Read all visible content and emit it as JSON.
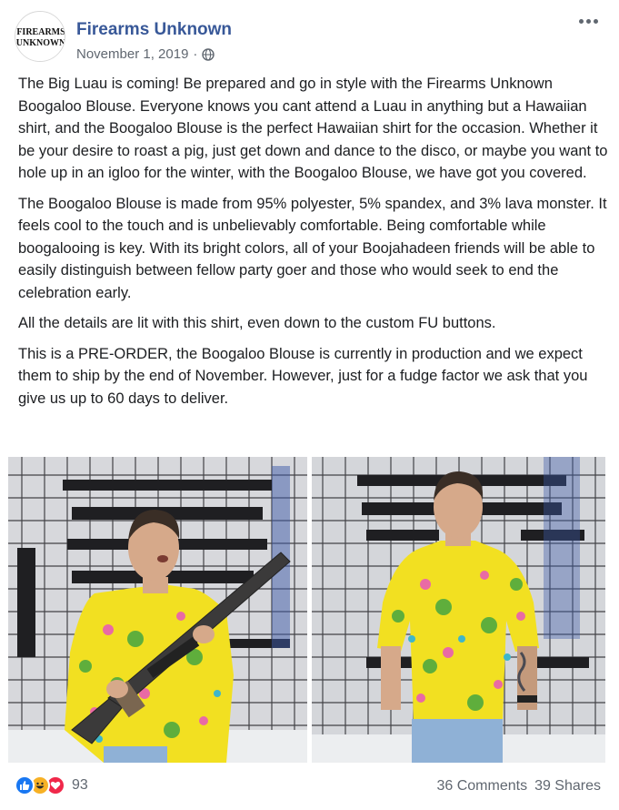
{
  "post": {
    "page_name": "Firearms Unknown",
    "date": "November 1, 2019",
    "separator": "·",
    "avatar_text_top": "FIREARMS",
    "avatar_text_bottom": "UNKNOWN",
    "paragraphs": [
      "The Big Luau is coming! Be prepared and go in style with the Firearms Unknown Boogaloo Blouse. Everyone knows you cant attend a Luau in anything but a Hawaiian shirt, and the Boogaloo Blouse is the perfect Hawaiian shirt for the occasion. Whether it be your desire to roast a pig, just get down and dance to the disco, or maybe you want to hole up in an igloo for the winter, with the Boogaloo Blouse, we have got you covered.",
      "The Boogaloo Blouse is made from 95% polyester, 5% spandex, and 3% lava monster. It feels cool to the touch and is unbelievably comfortable. Being comfortable while boogalooing is key. With its bright colors, all of your Boojahadeen friends will be able to easily distinguish between fellow party goer and those who would seek to end the celebration early.",
      "All the details are lit with this shirt, even down to the custom FU buttons.",
      "This is a PRE-ORDER, the Boogaloo Blouse is currently in production and we expect them to ship by the end of November. However, just for a fudge factor we ask that you give us up to 60 days to deliver."
    ]
  },
  "footer": {
    "reaction_count": "93",
    "comments": "36 Comments",
    "shares": "39 Shares"
  },
  "colors": {
    "link": "#385898",
    "secondary_text": "#606770",
    "shirt_yellow": "#f2e021",
    "like_blue": "#1877f2",
    "haha_yellow": "#f7b125",
    "love_red": "#f0284a"
  },
  "icons": [
    "globe-icon",
    "more-options-icon",
    "like-reaction-icon",
    "haha-reaction-icon",
    "love-reaction-icon"
  ]
}
